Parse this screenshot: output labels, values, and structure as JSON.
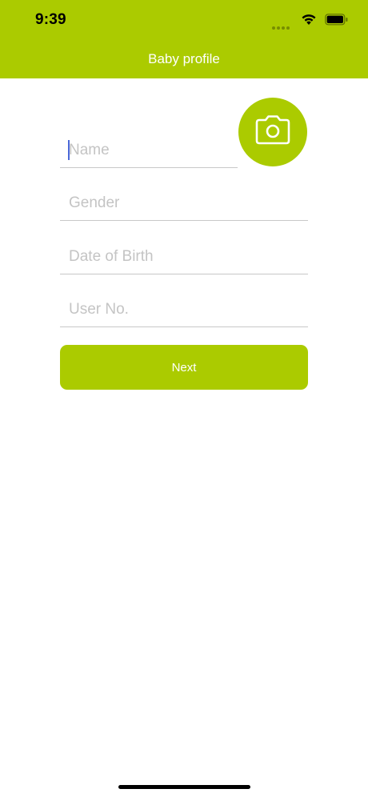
{
  "status_bar": {
    "time": "9:39"
  },
  "nav": {
    "title": "Baby profile"
  },
  "form": {
    "name_placeholder": "Name",
    "gender_placeholder": "Gender",
    "dob_placeholder": "Date of Birth",
    "user_no_placeholder": "User No."
  },
  "actions": {
    "next_label": "Next"
  },
  "icons": {
    "camera": "camera-icon",
    "wifi": "wifi-icon",
    "battery": "battery-icon",
    "signal": "cellular-signal-icon"
  },
  "colors": {
    "accent": "#abcb00",
    "caret": "#4a68d8",
    "placeholder": "#c4c4c4",
    "divider": "#c8c8c8"
  }
}
